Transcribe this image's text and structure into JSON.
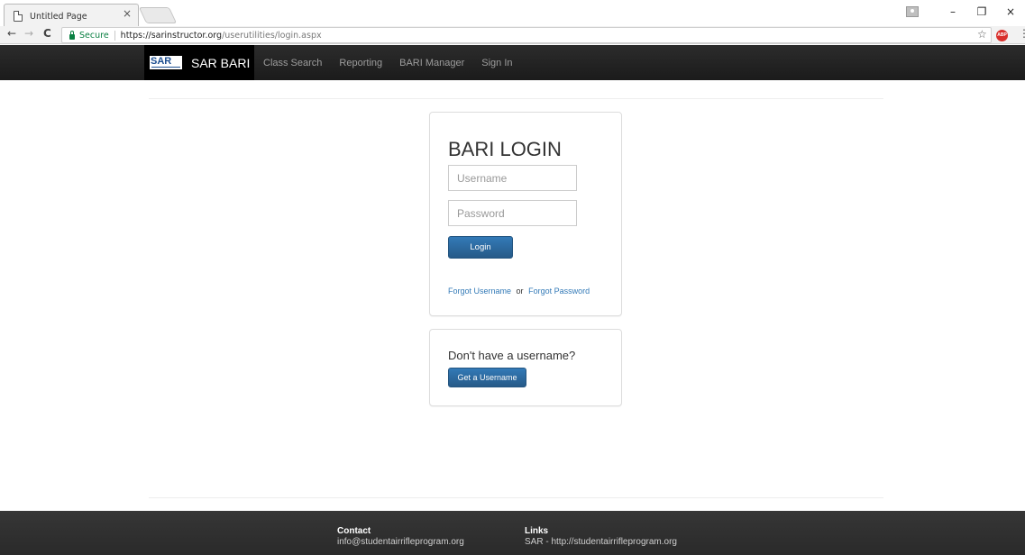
{
  "browser": {
    "tab_title": "Untitled Page",
    "tab_close": "×",
    "secure_label": "Secure",
    "url_base": "https://sarinstructor.org",
    "url_path": "/userutilities/login.aspx",
    "back_icon": "←",
    "forward_icon": "→",
    "reload_icon": "C",
    "star_icon": "☆",
    "abp_label": "ABP",
    "menu_icon": "⋮",
    "minimize_icon": "–",
    "restore_icon": "❐",
    "close_icon": "×"
  },
  "navbar": {
    "logo_text": "SAR",
    "brand": "SAR BARI",
    "links": [
      "Class Search",
      "Reporting",
      "BARI Manager",
      "Sign In"
    ]
  },
  "login": {
    "title": "BARI LOGIN",
    "username_placeholder": "Username",
    "password_placeholder": "Password",
    "login_button": "Login",
    "forgot_username": "Forgot Username",
    "or_text": "or",
    "forgot_password": "Forgot Password"
  },
  "signup": {
    "question": "Don't have a username?",
    "button": "Get a Username"
  },
  "footer": {
    "contact_heading": "Contact",
    "contact_email": "info@studentairrifleprogram.org",
    "links_heading": "Links",
    "links_text": "SAR - http://studentairrifleprogram.org"
  },
  "colors": {
    "navbar_bg": "#222222",
    "brand_bg": "#000000",
    "primary_button": "#337ab7",
    "link": "#337ab7",
    "footer_bg": "#333333",
    "secure_green": "#0b8043"
  }
}
